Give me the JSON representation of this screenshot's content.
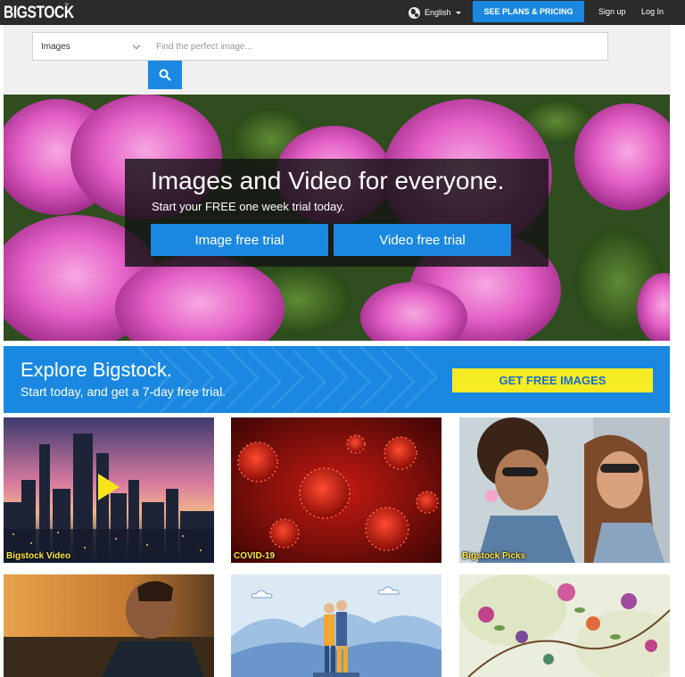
{
  "header": {
    "logo": "BIGSTOCK",
    "logo_tm": "™",
    "language": "English",
    "plans_button": "SEE PLANS & PRICING",
    "signup": "Sign up",
    "login": "Log In"
  },
  "search": {
    "type_selected": "Images",
    "placeholder": "Find the perfect image..."
  },
  "hero": {
    "title": "Images and Video for everyone.",
    "subtitle": "Start your FREE one week trial today.",
    "image_trial": "Image free trial",
    "video_trial": "Video free trial"
  },
  "explore": {
    "title": "Explore Bigstock.",
    "subtitle": "Start today, and get a 7-day free trial.",
    "cta": "GET FREE IMAGES"
  },
  "tiles": [
    {
      "label": "Bigstock Video"
    },
    {
      "label": "COVID-19"
    },
    {
      "label": "Bigstock Picks"
    }
  ],
  "colors": {
    "topbar": "#2b2b2b",
    "accent_blue": "#1a88e0",
    "cta_yellow": "#f6ec24",
    "tile_label": "#ffe94a"
  }
}
